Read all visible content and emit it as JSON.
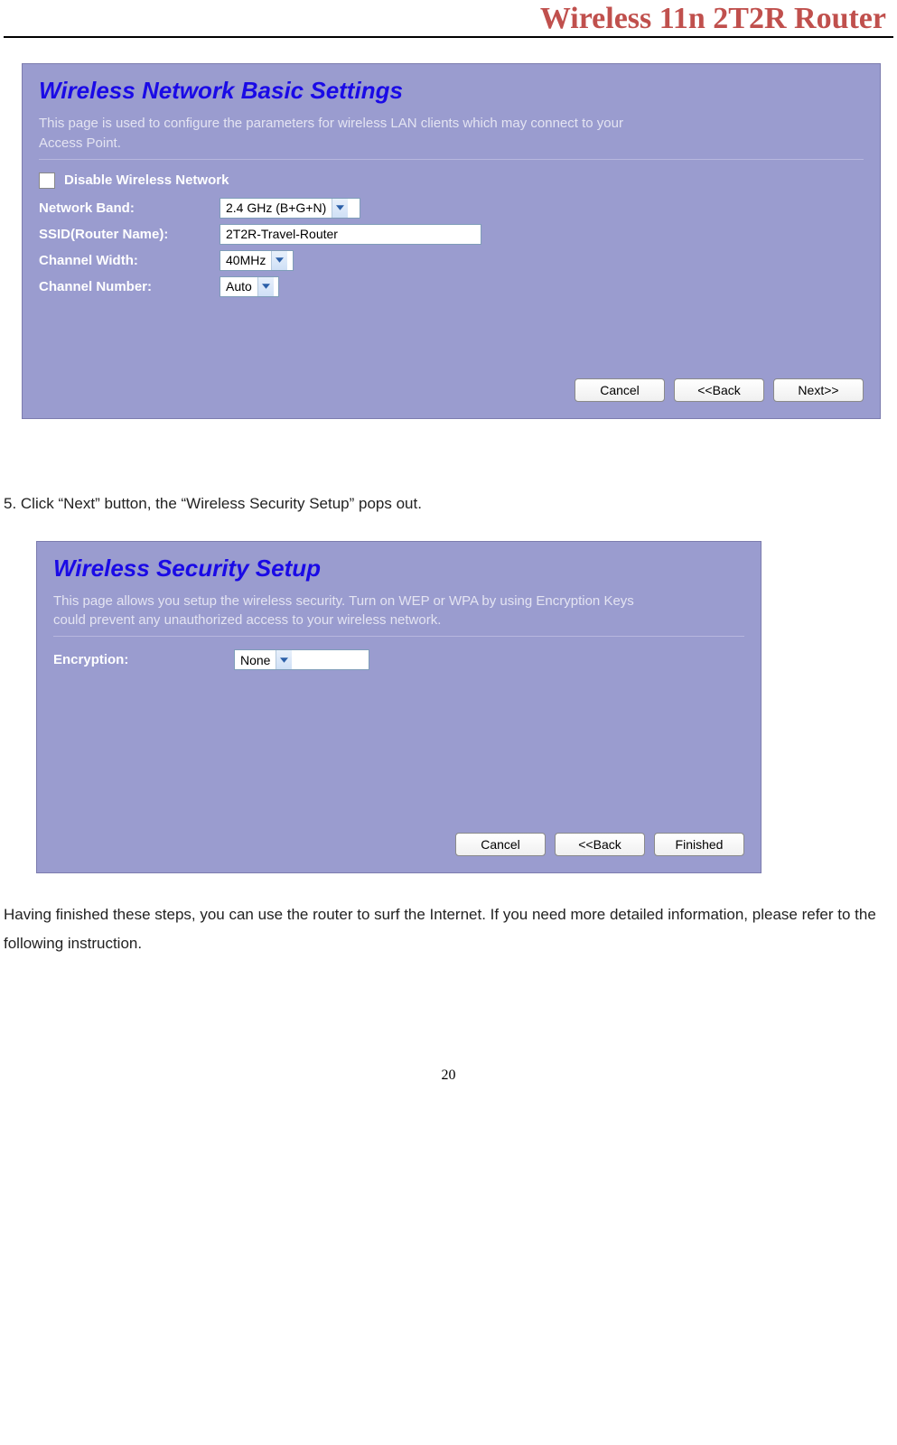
{
  "header": {
    "title": "Wireless 11n 2T2R Router"
  },
  "panel1": {
    "title": "Wireless Network Basic Settings",
    "desc": "This page is used to configure the parameters for wireless LAN clients which may connect to your Access Point.",
    "checkbox_label": "Disable Wireless Network",
    "rows": {
      "band_label": "Network Band:",
      "band_value": "2.4 GHz (B+G+N)",
      "ssid_label": "SSID(Router Name):",
      "ssid_value": "2T2R-Travel-Router",
      "width_label": "Channel Width:",
      "width_value": "40MHz",
      "chan_label": "Channel Number:",
      "chan_value": "Auto"
    },
    "buttons": {
      "cancel": "Cancel",
      "back": "<<Back",
      "next": "Next>>"
    }
  },
  "instruction": "5. Click “Next” button, the “Wireless Security Setup” pops out.",
  "panel2": {
    "title": "Wireless Security Setup",
    "desc": "This page allows you setup the wireless security. Turn on WEP or WPA by using Encryption Keys could prevent any unauthorized access to your wireless network.",
    "enc_label": "Encryption:",
    "enc_value": "None",
    "buttons": {
      "cancel": "Cancel",
      "back": "<<Back",
      "finished": "Finished"
    }
  },
  "closing": "Having finished these steps, you can use the router to surf the Internet. If you need more detailed information, please refer to the following instruction.",
  "page_number": "20"
}
